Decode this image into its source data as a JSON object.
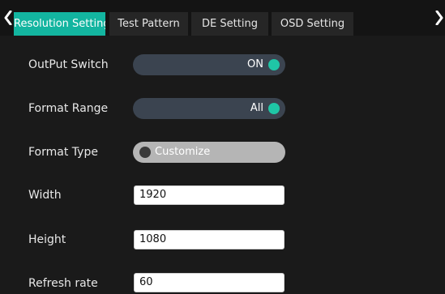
{
  "tabs": [
    {
      "label": "Resolution Setting",
      "active": true
    },
    {
      "label": "Test Pattern",
      "active": false
    },
    {
      "label": "DE Setting",
      "active": false
    },
    {
      "label": "OSD Setting",
      "active": false
    }
  ],
  "nav": {
    "prev_icon": "chevron-left-icon",
    "next_icon": "chevron-right-icon"
  },
  "settings": {
    "output_switch": {
      "label": "OutPut Switch",
      "value": "ON"
    },
    "format_range": {
      "label": "Format Range",
      "value": "All"
    },
    "format_type": {
      "label": "Format Type",
      "value": "Customize"
    },
    "width": {
      "label": "Width",
      "value": "1920"
    },
    "height": {
      "label": "Height",
      "value": "1080"
    },
    "refresh_rate": {
      "label": "Refresh rate",
      "value": "60"
    }
  },
  "colors": {
    "accent": "#13b5a0",
    "knob_on": "#1fc6a6",
    "panel_bg": "#1a1a1a",
    "toggle_on_bg": "#3b4450",
    "toggle_off_bg": "#b5b5b5"
  }
}
